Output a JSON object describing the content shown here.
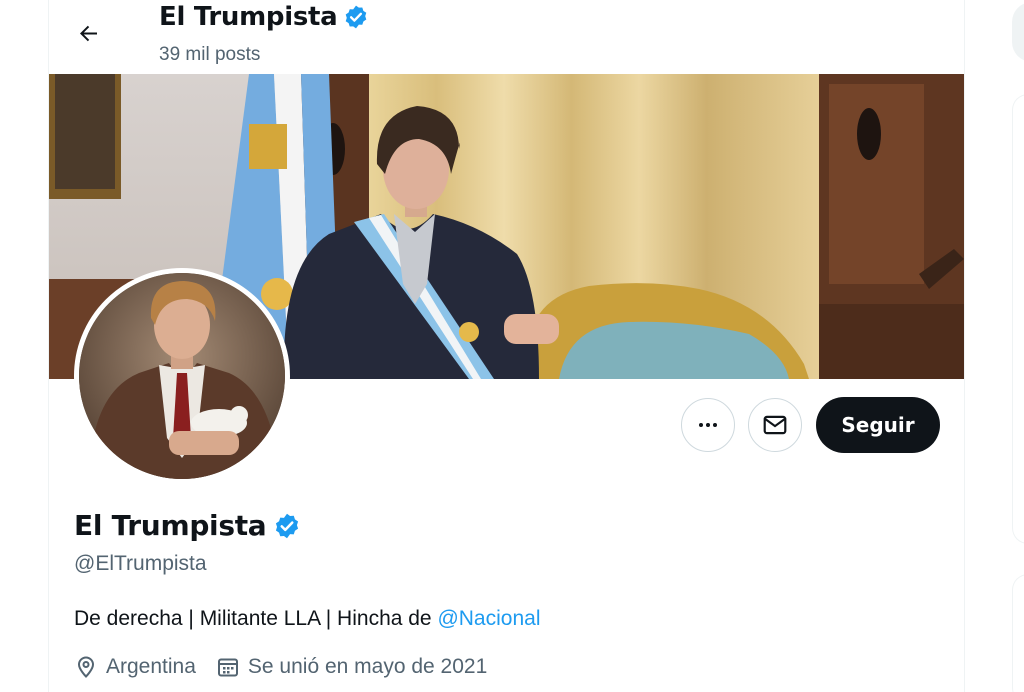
{
  "header": {
    "name": "El Trumpista",
    "posts_count": "39 mil posts"
  },
  "profile": {
    "name": "El Trumpista",
    "handle": "@ElTrumpista",
    "bio_prefix": "De derecha | Militante LLA | Hincha de ",
    "bio_mention": "@Nacional",
    "location": "Argentina",
    "joined": "Se unió en mayo de 2021"
  },
  "actions": {
    "follow_label": "Seguir"
  },
  "icons": {
    "back": "arrow-left-icon",
    "verified": "verified-badge-icon",
    "more": "more-horizontal-icon",
    "message": "mail-icon",
    "location": "map-pin-icon",
    "calendar": "calendar-icon"
  },
  "colors": {
    "verified": "#1d9bf0",
    "link": "#1d9bf0",
    "follow_bg": "#0f1419",
    "secondary_text": "#536471"
  }
}
